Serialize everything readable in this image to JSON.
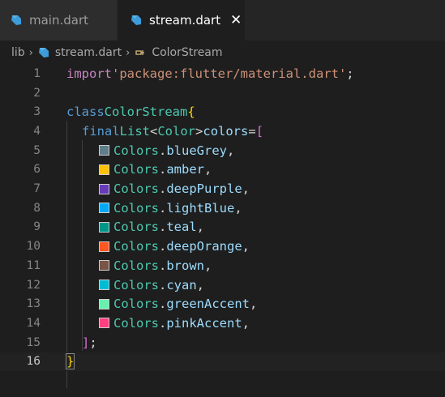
{
  "tabs": [
    {
      "label": "main.dart",
      "active": false
    },
    {
      "label": "stream.dart",
      "active": true,
      "close": "✕"
    }
  ],
  "breadcrumb": {
    "folder": "lib",
    "file": "stream.dart",
    "symbol": "ColorStream"
  },
  "colors": {
    "dart_icon": "#3d9cd9",
    "symbol_icon": "#d7ba7d"
  },
  "code": {
    "line_numbers": [
      "1",
      "2",
      "3",
      "4",
      "5",
      "6",
      "7",
      "8",
      "9",
      "10",
      "11",
      "12",
      "13",
      "14",
      "15",
      "16"
    ],
    "import_kw": "import",
    "import_path": "'package:flutter/material.dart'",
    "semicolon": ";",
    "class_kw": "class",
    "class_name": "ColorStream",
    "open_brace": "{",
    "final_kw": "final",
    "list_type": "List",
    "lt": "<",
    "color_type": "Color",
    "gt": ">",
    "colors_var": "colors",
    "eq": "=",
    "open_bracket": "[",
    "entries": [
      {
        "cls": "Colors",
        "name": "blueGrey",
        "swatch": "#607d8b"
      },
      {
        "cls": "Colors",
        "name": "amber",
        "swatch": "#ffc107"
      },
      {
        "cls": "Colors",
        "name": "deepPurple",
        "swatch": "#673ab7"
      },
      {
        "cls": "Colors",
        "name": "lightBlue",
        "swatch": "#03a9f4"
      },
      {
        "cls": "Colors",
        "name": "teal",
        "swatch": "#009688"
      },
      {
        "cls": "Colors",
        "name": "deepOrange",
        "swatch": "#ff5722"
      },
      {
        "cls": "Colors",
        "name": "brown",
        "swatch": "#795548"
      },
      {
        "cls": "Colors",
        "name": "cyan",
        "swatch": "#00bcd4"
      },
      {
        "cls": "Colors",
        "name": "greenAccent",
        "swatch": "#69f0ae"
      },
      {
        "cls": "Colors",
        "name": "pinkAccent",
        "swatch": "#ff4081"
      }
    ],
    "dot": ".",
    "comma": ",",
    "close_bracket": "];",
    "close_brace": "}"
  }
}
